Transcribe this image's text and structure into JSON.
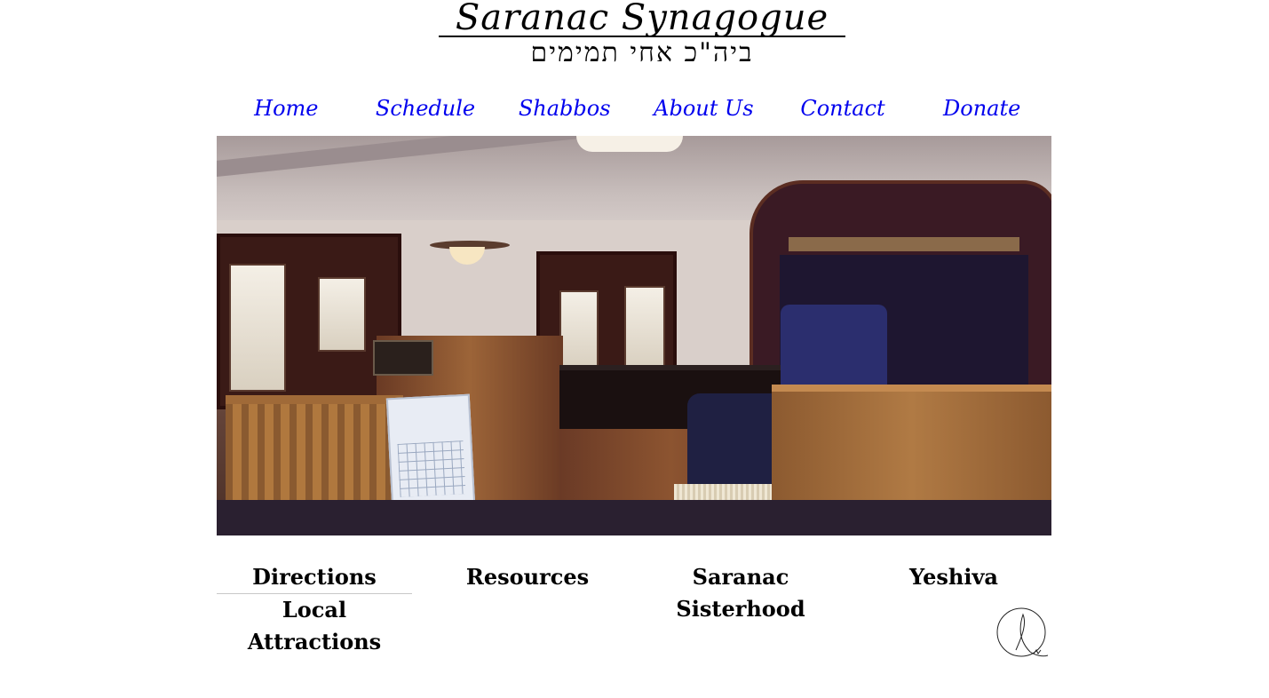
{
  "logo": {
    "title": "Saranac Synagogue",
    "hebrew": "ביה\"כ אחי תמימים"
  },
  "nav": {
    "items": [
      {
        "label": "Home"
      },
      {
        "label": "Schedule"
      },
      {
        "label": "Shabbos"
      },
      {
        "label": "About Us"
      },
      {
        "label": "Contact"
      },
      {
        "label": "Donate"
      }
    ]
  },
  "links": {
    "directions": "Directions",
    "local_attractions": "Local Attractions",
    "resources": "Resources",
    "sisterhood": "Saranac Sisterhood",
    "yeshiva": "Yeshiva"
  },
  "colors": {
    "nav_link": "#0000ee",
    "text": "#000000",
    "background": "#ffffff"
  },
  "icons": {
    "site_badge": "signature-circle-icon"
  }
}
